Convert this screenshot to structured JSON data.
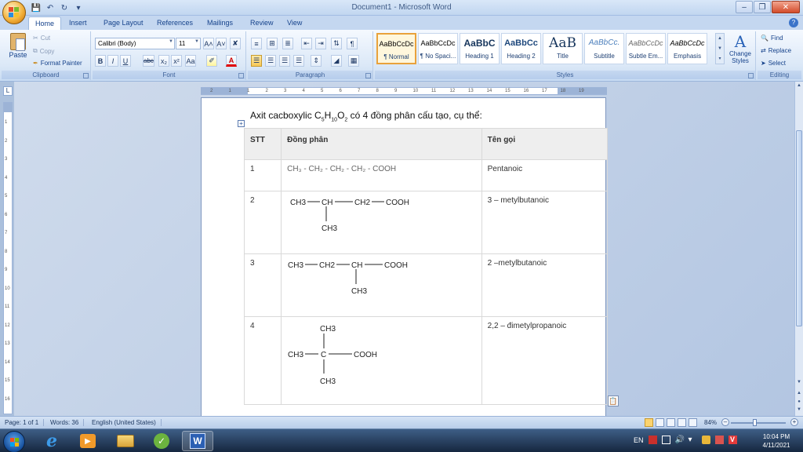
{
  "window": {
    "title": "Document1 - Microsoft Word"
  },
  "tabs": [
    "Home",
    "Insert",
    "Page Layout",
    "References",
    "Mailings",
    "Review",
    "View"
  ],
  "ribbon": {
    "clipboard": {
      "label": "Clipboard",
      "paste": "Paste",
      "cut": "Cut",
      "copy": "Copy",
      "format_painter": "Format Painter"
    },
    "font": {
      "label": "Font",
      "font_name": "Calibri (Body)",
      "font_size": "11",
      "grow": "A˄",
      "shrink": "A˅",
      "bold": "B",
      "italic": "I",
      "underline": "U",
      "strike": "abc",
      "subscript": "x₂",
      "superscript": "x²",
      "change_case": "Aa"
    },
    "paragraph": {
      "label": "Paragraph",
      "pilcrow": "¶"
    },
    "styles": {
      "label": "Styles",
      "items": [
        {
          "preview": "AaBbCcDc",
          "name": "¶ Normal",
          "selected": true
        },
        {
          "preview": "AaBbCcDc",
          "name": "¶ No Spaci..."
        },
        {
          "preview": "AaBbC",
          "name": "Heading 1"
        },
        {
          "preview": "AaBbCc",
          "name": "Heading 2"
        },
        {
          "preview": "AaB",
          "name": "Title"
        },
        {
          "preview": "AaBbCc.",
          "name": "Subtitle"
        },
        {
          "preview": "AaBbCcDc",
          "name": "Subtle Em..."
        },
        {
          "preview": "AaBbCcDc",
          "name": "Emphasis"
        }
      ],
      "change_styles": "Change Styles"
    },
    "editing": {
      "label": "Editing",
      "find": "Find",
      "replace": "Replace",
      "select": "Select"
    }
  },
  "ruler": {
    "h_ticks": [
      "2",
      "1",
      "1",
      "2",
      "3",
      "4",
      "5",
      "6",
      "7",
      "8",
      "9",
      "10",
      "11",
      "12",
      "13",
      "14",
      "15",
      "16",
      "17",
      "18",
      "19"
    ],
    "v_ticks": [
      "1",
      "2",
      "3",
      "4",
      "5",
      "6",
      "7",
      "8",
      "9",
      "10",
      "11",
      "12",
      "13",
      "14",
      "15",
      "16"
    ]
  },
  "document": {
    "heading_prefix": "Axit cacboxylic C",
    "heading_c_sub": "5",
    "heading_h": "H",
    "heading_h_sub": "10",
    "heading_o": "O",
    "heading_o_sub": "2",
    "heading_suffix": " có 4 đồng phân cấu tạo, cụ thể:",
    "table": {
      "headers": [
        "STT",
        "Đồng phân",
        "Tên gọi"
      ],
      "rows": [
        {
          "stt": "1",
          "formula": "CH₃ - CH₂ - CH₂ - CH₂ - COOH",
          "name": "Pentanoic"
        },
        {
          "stt": "2",
          "formula_main": [
            "CH3",
            "CH",
            "CH2",
            "COOH"
          ],
          "formula_branch": "CH3",
          "name": "3 – metylbutanoic"
        },
        {
          "stt": "3",
          "formula_main": [
            "CH3",
            "CH2",
            "CH",
            "COOH"
          ],
          "formula_branch": "CH3",
          "name": "2 –metylbutanoic"
        },
        {
          "stt": "4",
          "formula_main": [
            "CH3",
            "C",
            "COOH"
          ],
          "formula_top": "CH3",
          "formula_bottom": "CH3",
          "name": "2,2 – đimetylpropanoic"
        }
      ]
    }
  },
  "status": {
    "page": "Page: 1 of 1",
    "words": "Words: 36",
    "language": "English (United States)",
    "zoom": "84%"
  },
  "taskbar": {
    "lang": "EN",
    "time": "10:04 PM",
    "date": "4/11/2021"
  }
}
